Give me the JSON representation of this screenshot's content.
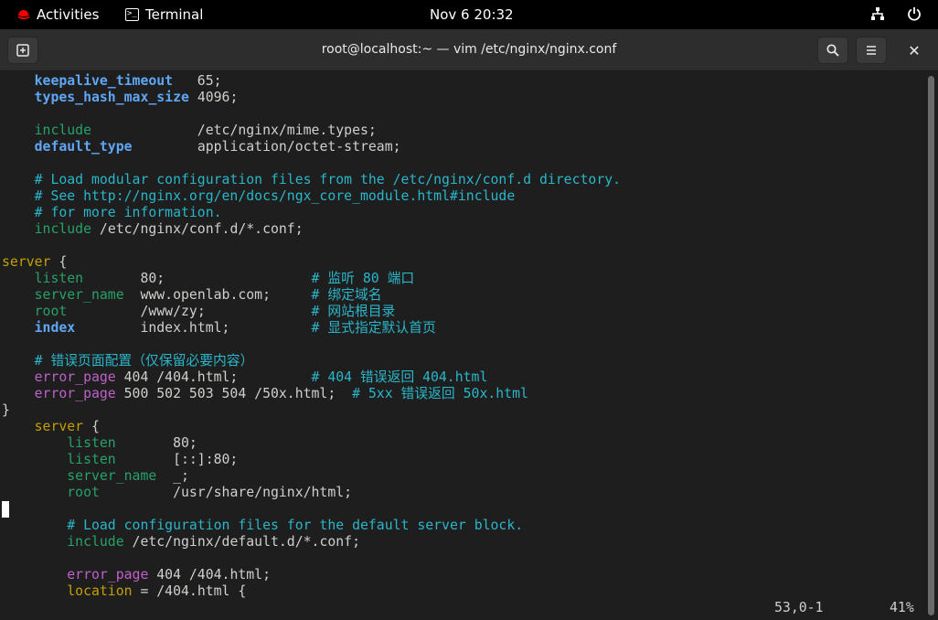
{
  "topbar": {
    "activities": "Activities",
    "app_name": "Terminal",
    "clock": "Nov 6  20:32",
    "icons": {
      "brand": "redhat-icon",
      "app": "terminal-icon",
      "network": "network-icon",
      "power": "power-icon"
    }
  },
  "window": {
    "title": "root@localhost:~ — vim /etc/nginx/nginx.conf",
    "icons": {
      "new_tab": "new-tab-icon",
      "search": "search-icon",
      "menu": "hamburger-menu-icon",
      "close": "close-icon"
    }
  },
  "editor": {
    "lines": [
      {
        "t": "kw",
        "a": "    keepalive_timeout",
        "b": "   65;"
      },
      {
        "t": "kw",
        "a": "    types_hash_max_size",
        "b": " 4096;"
      },
      {
        "t": "blank"
      },
      {
        "t": "dir",
        "a": "    include",
        "b": "             /etc/nginx/mime.types;"
      },
      {
        "t": "kw",
        "a": "    default_type",
        "b": "        application/octet-stream;"
      },
      {
        "t": "blank"
      },
      {
        "t": "cm",
        "a": "    # Load modular configuration files from the /etc/nginx/conf.d directory."
      },
      {
        "t": "cm",
        "a": "    # See http://nginx.org/en/docs/ngx_core_module.html#include"
      },
      {
        "t": "cm",
        "a": "    # for more information."
      },
      {
        "t": "dir",
        "a": "    include",
        "b": " /etc/nginx/conf.d/*.conf;"
      },
      {
        "t": "blank"
      },
      {
        "t": "blk",
        "a": "server",
        "b": " {"
      },
      {
        "t": "dirc",
        "a": "    listen",
        "b": "       80;                  ",
        "c": "# 监听 80 端口"
      },
      {
        "t": "dirc",
        "a": "    server_name",
        "b": "  www.openlab.com;     ",
        "c": "# 绑定域名"
      },
      {
        "t": "dirc",
        "a": "    root",
        "b": "         /www/zy;             ",
        "c": "# 网站根目录"
      },
      {
        "t": "kwc",
        "a": "    index",
        "b": "        index.html;          ",
        "c": "# 显式指定默认首页"
      },
      {
        "t": "blank"
      },
      {
        "t": "cm",
        "a": "    # 错误页面配置（仅保留必要内容）"
      },
      {
        "t": "dir2c",
        "a": "    error_page",
        "b": " 404 /404.html;         ",
        "c": "# 404 错误返回 404.html"
      },
      {
        "t": "dir2c",
        "a": "    error_page",
        "b": " 500 502 503 504 /50x.html;  ",
        "c": "# 5xx 错误返回 50x.html"
      },
      {
        "t": "tx",
        "a": "}"
      },
      {
        "t": "blk",
        "a": "    server",
        "b": " {"
      },
      {
        "t": "dir",
        "a": "        listen",
        "b": "       80;"
      },
      {
        "t": "dir",
        "a": "        listen",
        "b": "       [::]:80;"
      },
      {
        "t": "dir",
        "a": "        server_name",
        "b": "  _;"
      },
      {
        "t": "dir",
        "a": "        root",
        "b": "         /usr/share/nginx/html;"
      },
      {
        "t": "blank"
      },
      {
        "t": "cm",
        "a": "        # Load configuration files for the default server block."
      },
      {
        "t": "dir",
        "a": "        include",
        "b": " /etc/nginx/default.d/*.conf;"
      },
      {
        "t": "blank"
      },
      {
        "t": "dir2",
        "a": "        error_page",
        "b": " 404 /404.html;"
      },
      {
        "t": "blk",
        "a": "        location",
        "b": " = /404.html {"
      }
    ],
    "status_position": "53,0-1",
    "status_percent": "41%"
  }
}
